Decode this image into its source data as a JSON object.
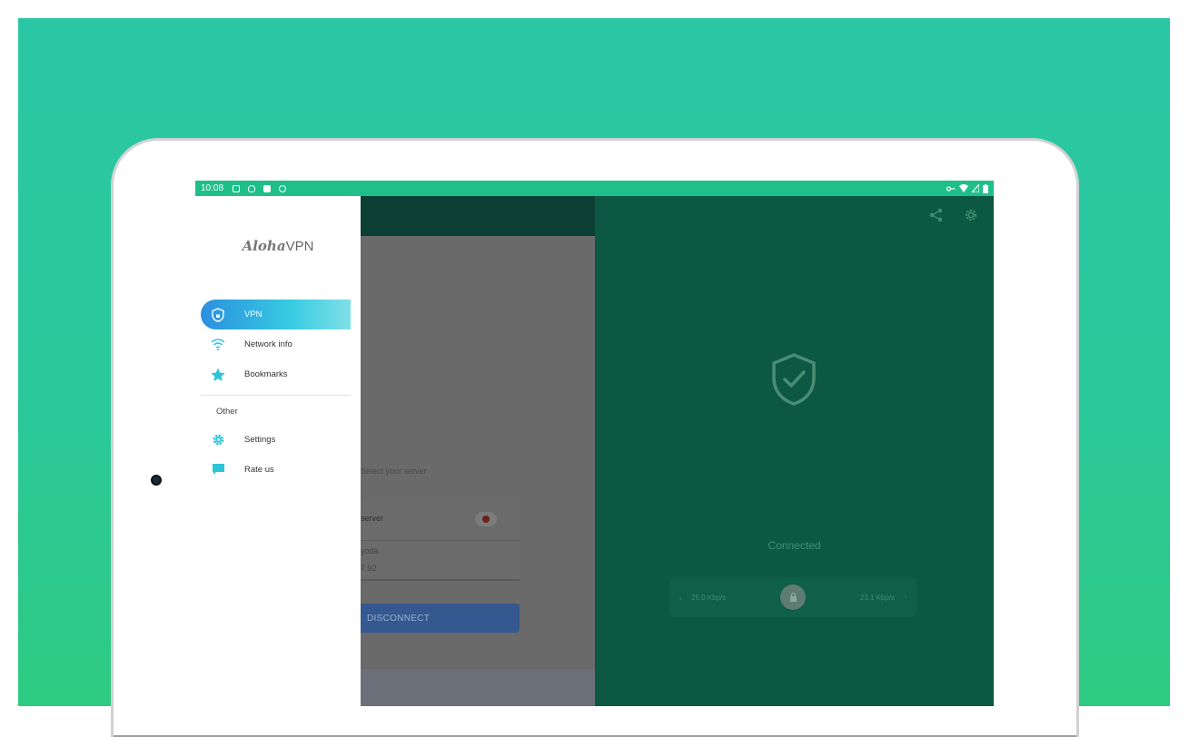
{
  "status_bar": {
    "time": "10:08"
  },
  "drawer": {
    "logo_script": "Aloha",
    "logo_text": "VPN",
    "items": [
      {
        "label": "VPN",
        "icon": "vpn-shield-icon",
        "active": true
      },
      {
        "label": "Network info",
        "icon": "wifi-icon"
      },
      {
        "label": "Bookmarks",
        "icon": "star-icon"
      }
    ],
    "section_label": "Other",
    "other_items": [
      {
        "label": "Settings",
        "icon": "gear-icon"
      },
      {
        "label": "Rate us",
        "icon": "chat-bubble-icon"
      }
    ]
  },
  "server_panel": {
    "select_label": "Select your server",
    "server_label": "server",
    "city": "yoda",
    "ip": "7.92",
    "disconnect_label": "DISCONNECT"
  },
  "main": {
    "status": "Connected",
    "download_speed": "25.0 Kbp/s",
    "upload_speed": "23.1 Kbp/s"
  },
  "colors": {
    "brand_green": "#2bc7a4",
    "status_bar": "#1fbf8a",
    "main_bg": "#0d5843",
    "active_gradient_start": "#2b8fe0",
    "active_gradient_end": "#7fe0e8",
    "icon_accent": "#2ec4d8"
  }
}
